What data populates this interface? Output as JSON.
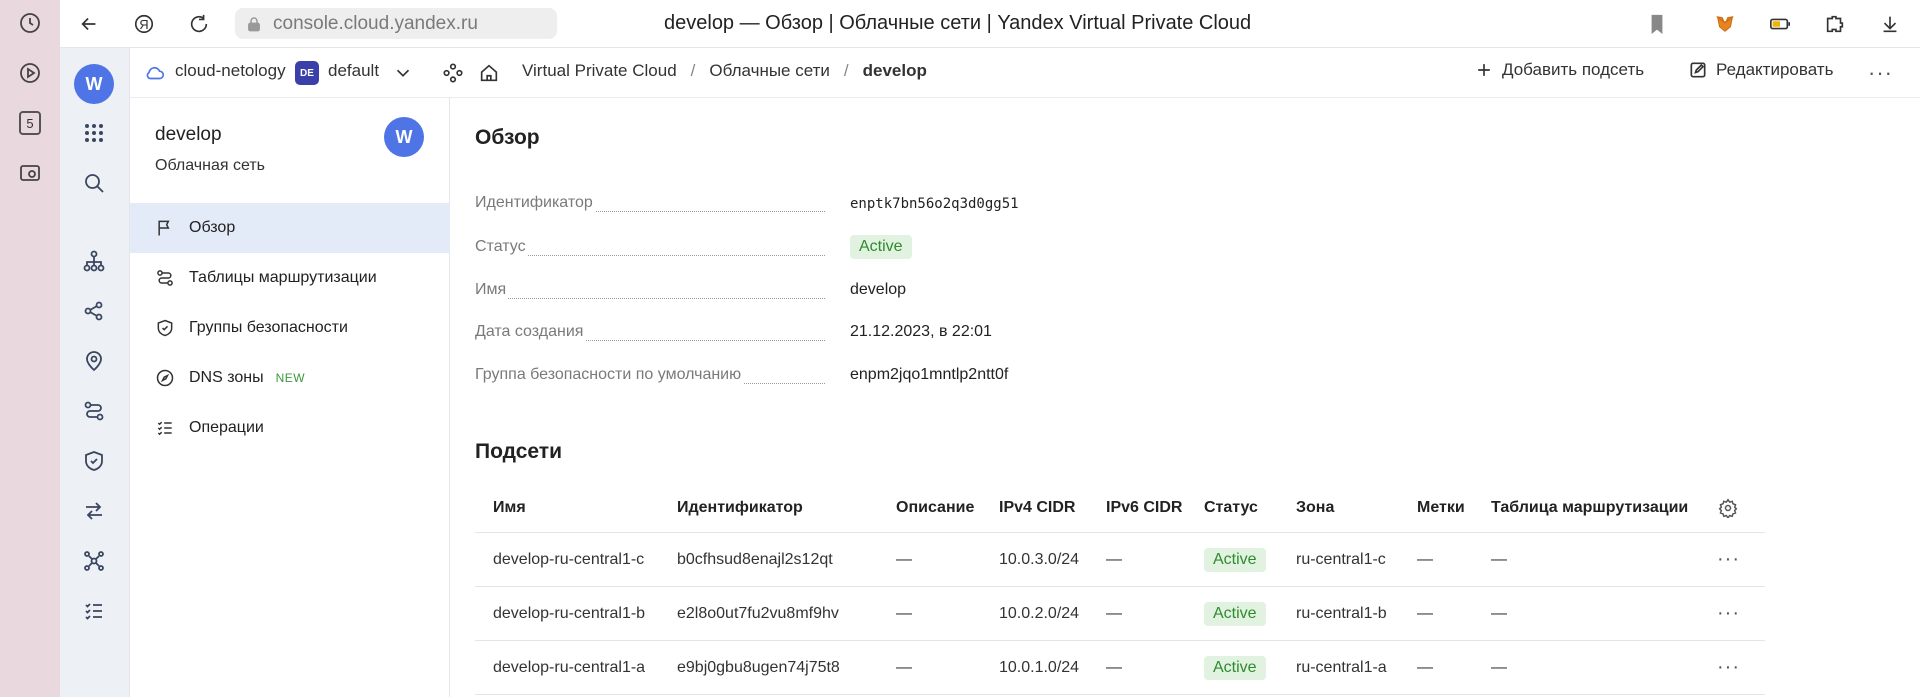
{
  "browser": {
    "url": "console.cloud.yandex.ru",
    "page_title": "develop — Обзор | Облачные сети | Yandex Virtual Private Cloud",
    "side_badge": "5",
    "yandex_button": "Я"
  },
  "console": {
    "cloud_name": "cloud-netology",
    "folder_badge": "DE",
    "folder_name": "default",
    "rail_logo": "W",
    "breadcrumbs": [
      "Virtual Private Cloud",
      "/",
      "Облачные сети",
      "/",
      "develop"
    ],
    "add_subnet_label": "Добавить подсеть",
    "edit_label": "Редактировать",
    "more_label": "···"
  },
  "service": {
    "resource_name": "develop",
    "resource_type": "Облачная сеть",
    "logo": "W",
    "menu": [
      {
        "label": "Обзор",
        "icon": "flag-icon",
        "active": true
      },
      {
        "label": "Таблицы маршрутизации",
        "icon": "route-icon"
      },
      {
        "label": "Группы безопасности",
        "icon": "shield-icon"
      },
      {
        "label": "DNS зоны",
        "icon": "compass-icon",
        "badge": "NEW"
      },
      {
        "label": "Операции",
        "icon": "list-check-icon"
      }
    ]
  },
  "overview": {
    "title": "Обзор",
    "fields": [
      {
        "key": "Идентификатор",
        "value": "enptk7bn56o2q3d0gg51"
      },
      {
        "key": "Статус",
        "value": "Active"
      },
      {
        "key": "Имя",
        "value": "develop"
      },
      {
        "key": "Дата создания",
        "value": "21.12.2023, в 22:01"
      },
      {
        "key": "Группа безопасности по умолчанию",
        "value": "enpm2jqo1mntlp2ntt0f"
      }
    ]
  },
  "subnets": {
    "title": "Подсети",
    "columns": [
      "Имя",
      "Идентификатор",
      "Описание",
      "IPv4 CIDR",
      "IPv6 CIDR",
      "Статус",
      "Зона",
      "Метки",
      "Таблица маршрутизации"
    ],
    "rows": [
      [
        "develop-ru-central1-c",
        "b0cfhsud8enajl2s12qt",
        "—",
        "10.0.3.0/24",
        "—",
        "Active",
        "ru-central1-c",
        "—",
        "—"
      ],
      [
        "develop-ru-central1-b",
        "e2l8o0ut7fu2vu8mf9hv",
        "—",
        "10.0.2.0/24",
        "—",
        "Active",
        "ru-central1-b",
        "—",
        "—"
      ],
      [
        "develop-ru-central1-a",
        "e9bj0gbu8ugen74j75t8",
        "—",
        "10.0.1.0/24",
        "—",
        "Active",
        "ru-central1-a",
        "—",
        "—"
      ]
    ],
    "row_action": "···"
  },
  "colors": {
    "accent": "#4e74e6",
    "active_bg": "#e1f3e0",
    "active_text": "#2f8a2f",
    "menu_active_bg": "#e3eaf8"
  }
}
